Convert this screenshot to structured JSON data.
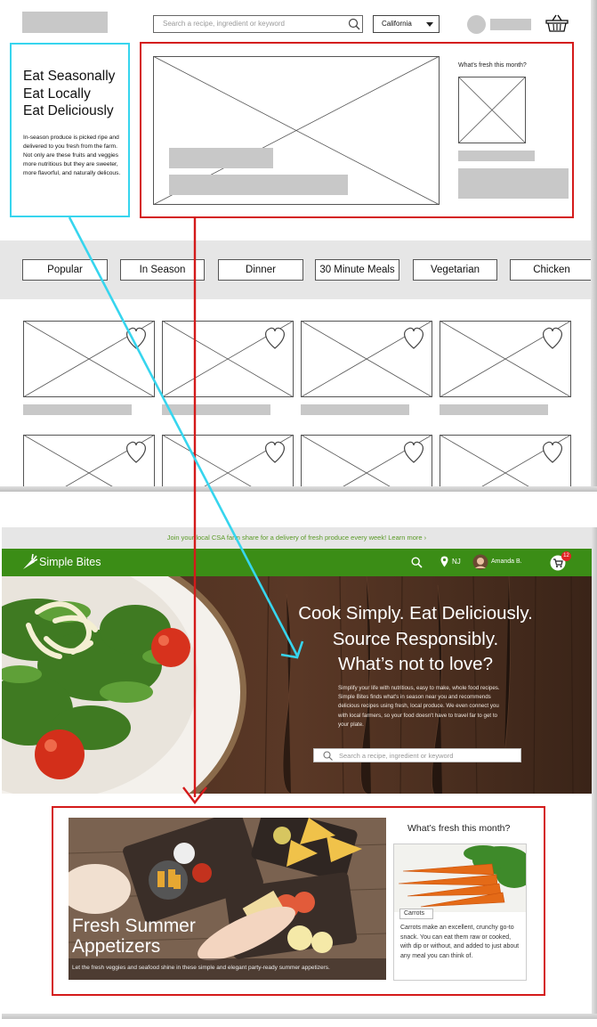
{
  "wireframe": {
    "search_placeholder": "Search a recipe, ingredient or keyword",
    "location_select": "California",
    "intro_headline": [
      "Eat Seasonally",
      "Eat Locally",
      "Eat Deliciously"
    ],
    "intro_body": "In-season produce is picked ripe and delivered to you fresh from the farm. Not only are these fruits and veggies more nutritious but they are sweeter, more flavorful, and naturally delicous.",
    "fresh_label": "What's fresh this month?",
    "categories": [
      "Popular",
      "In Season",
      "Dinner",
      "30 Minute Meals",
      "Vegetarian",
      "Chicken"
    ]
  },
  "final": {
    "promo_text": "Join your local CSA farm share for a delivery of fresh produce every week!  Learn more ›",
    "brand": "Simple Bites",
    "location": "NJ",
    "user_name": "Amanda B.",
    "cart_count": "12",
    "hero_headline": [
      "Cook Simply. Eat Deliciously.",
      "Source Responsibly.",
      "What’s not to love?"
    ],
    "hero_body": "Simplify your life with nutritious, easy to make, whole food recipes. Simple Bites finds what's in season near you and recommends delicious recipes using fresh, local produce. We even connect you with local farmers, so your food doesn't have to travel far to get to your plate.",
    "search_placeholder": "Search a recipe, ingredient or keyword",
    "featured_title": [
      "Fresh Summer",
      "Appetizers"
    ],
    "featured_caption": "Let the fresh veggies and seafood shine in these simple and elegant party-ready summer appetizers.",
    "fresh_title": "What’s fresh this month?",
    "fresh_item_label": "Carrots",
    "fresh_item_desc": "Carrots make an excellent, crunchy go-to snack. You can eat them raw or cooked, with dip or without, and added to just about any meal you can think of."
  },
  "colors": {
    "brand_green": "#3b8d16",
    "annotation_red": "#d41a1a",
    "annotation_cyan": "#37d5ee",
    "badge_red": "#e12424"
  }
}
